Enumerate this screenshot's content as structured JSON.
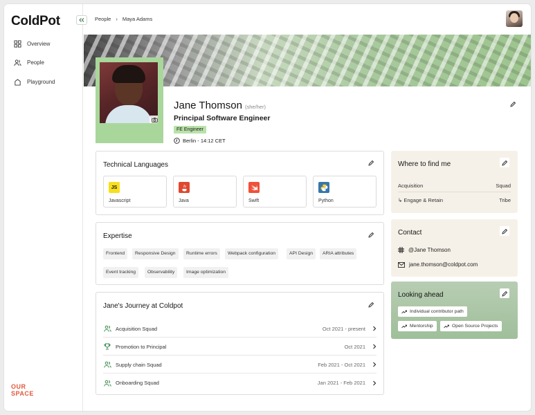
{
  "app": {
    "brand": "ColdPot",
    "logo_line1": "OUR",
    "logo_line2": "SPACE"
  },
  "sidebar": {
    "items": [
      {
        "label": "Overview"
      },
      {
        "label": "People"
      },
      {
        "label": "Playground"
      }
    ]
  },
  "breadcrumb": {
    "items": [
      "People",
      "Maya Adams"
    ]
  },
  "profile": {
    "name": "Jane Thomson",
    "pronouns": "(she/her)",
    "role": "Principal Software Engineer",
    "team": "FE Engineer",
    "location": "Berlin - 14:12 CET"
  },
  "technical_languages": {
    "title": "Technical Languages",
    "items": [
      {
        "name": "Javascript",
        "logo_text": "JS",
        "color": "#f7df1e"
      },
      {
        "name": "Java",
        "color": "#e0472f"
      },
      {
        "name": "Swift",
        "color": "#f05138"
      },
      {
        "name": "Python",
        "color": "#3776ab"
      }
    ]
  },
  "expertise": {
    "title": "Expertise",
    "chips": [
      "Frontend",
      "Responsive Design",
      "Runtime errors",
      "Webpack configuration",
      "API Design",
      "ARIA attributes",
      "Event tracking",
      "Observability",
      "Image optimization"
    ]
  },
  "journey": {
    "title": "Jane's Journey at Coldpot",
    "rows": [
      {
        "label": "Acquisition Squad",
        "date": "Oct 2021 - present",
        "icon": "people-icon"
      },
      {
        "label": "Promotion to Principal",
        "date": "Oct 2021",
        "icon": "trophy-icon"
      },
      {
        "label": "Supply chain Squad",
        "date": "Feb 2021 - Oct 2021",
        "icon": "people-icon"
      },
      {
        "label": "Onboarding Squad",
        "date": "Jan 2021 - Feb 2021",
        "icon": "people-icon"
      }
    ]
  },
  "where_to_find": {
    "title": "Where to find me",
    "rows": [
      {
        "key": "Acquisition",
        "value": "Squad"
      },
      {
        "key": "↳ Engage & Retain",
        "value": "Tribe"
      }
    ]
  },
  "contact": {
    "title": "Contact",
    "slack": "@Jane Thomson",
    "email": "jane.thomson@coldpot.com"
  },
  "looking_ahead": {
    "title": "Looking ahead",
    "chips": [
      "Individual contributor path",
      "Mentorship",
      "Open Source Projects"
    ]
  },
  "colors": {
    "accent_green": "#a9d79b",
    "badge_green": "#b8e2a8",
    "side_bg": "#f6f1e8",
    "ahead_bg": "#a9c5a5"
  }
}
